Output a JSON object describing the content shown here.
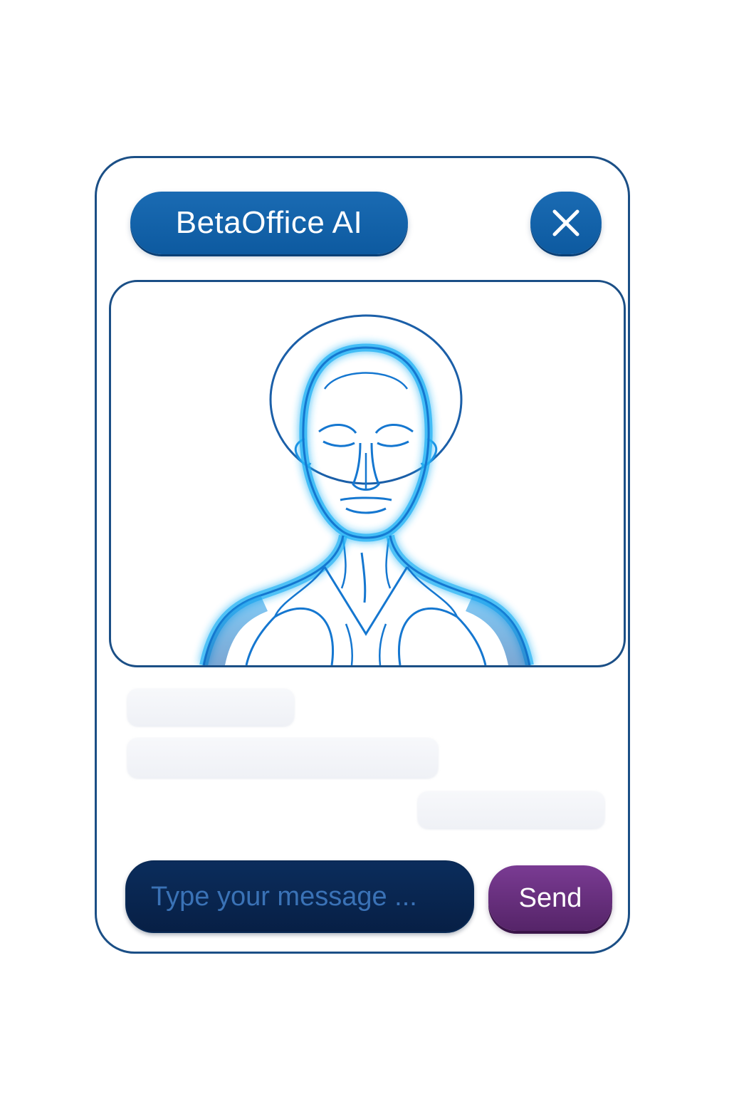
{
  "header": {
    "title": "BetaOffice AI",
    "close_icon": "close-icon"
  },
  "avatar": {
    "icon": "ai-assistant-avatar"
  },
  "composer": {
    "placeholder": "Type your message ...",
    "send_label": "Send"
  },
  "colors": {
    "frame_border": "#1b4f86",
    "header_pill": "#0d5aa0",
    "avatar_glow": "#1fa6f0",
    "input_bg": "#0b2d5c",
    "send_button": "#6a2f82"
  }
}
